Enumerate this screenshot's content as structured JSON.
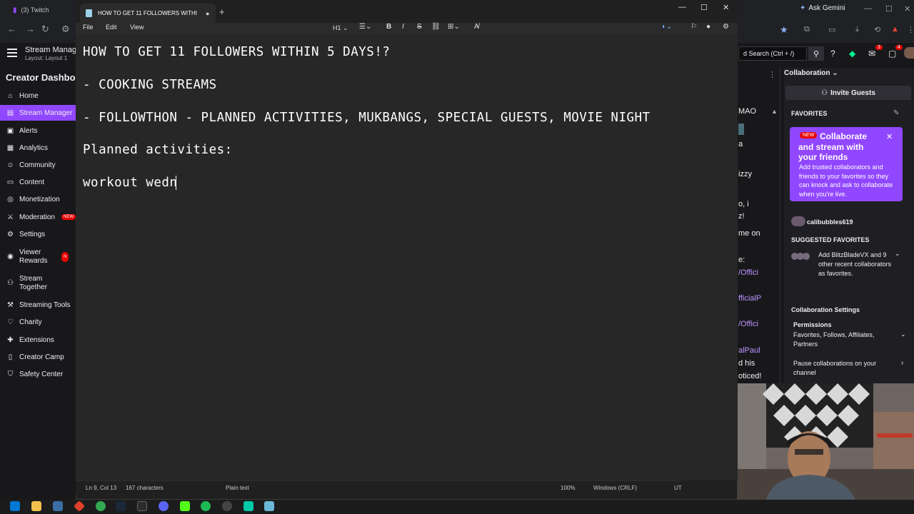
{
  "browser": {
    "tab_title": "(3) Twitch",
    "gemini_label": "Ask Gemini"
  },
  "twitch": {
    "stream_manager_title": "Stream Manage",
    "layout_label": "Layout: Layout 1",
    "creator_dashboard": "Creator Dashboa",
    "nav": [
      {
        "label": "Home",
        "icon": "home-icon"
      },
      {
        "label": "Stream Manager",
        "icon": "stream-manager-icon"
      },
      {
        "label": "Alerts",
        "icon": "alerts-icon"
      },
      {
        "label": "Analytics",
        "icon": "analytics-icon"
      },
      {
        "label": "Community",
        "icon": "community-icon"
      },
      {
        "label": "Content",
        "icon": "content-icon"
      },
      {
        "label": "Monetization",
        "icon": "monetization-icon"
      },
      {
        "label": "Moderation",
        "icon": "moderation-icon"
      },
      {
        "label": "Settings",
        "icon": "settings-icon"
      },
      {
        "label": "Viewer Rewards",
        "icon": "viewer-rewards-icon"
      },
      {
        "label": "Stream Together",
        "icon": "stream-together-icon"
      },
      {
        "label": "Streaming Tools",
        "icon": "streaming-tools-icon"
      },
      {
        "label": "Charity",
        "icon": "charity-icon"
      },
      {
        "label": "Extensions",
        "icon": "extensions-icon"
      },
      {
        "label": "Creator Camp",
        "icon": "creator-camp-icon"
      },
      {
        "label": "Safety Center",
        "icon": "safety-center-icon"
      }
    ],
    "new_badge": "NEW",
    "search_placeholder": "d Search (Ctrl + /)",
    "notif_count_1": "3",
    "notif_count_2": "4",
    "chat_fragments": [
      "MAO",
      "a",
      "izzy",
      "o, i",
      "z!",
      "me on",
      "e:",
      "/Offici",
      "fficialP",
      "/Offici",
      "alPaul",
      "d his",
      "oticed!"
    ],
    "collab": {
      "title": "Collaboration",
      "invite": "Invite Guests",
      "favorites_head": "FAVORITES",
      "new_label": "NEW",
      "card_title": "Collaborate and stream with your friends",
      "card_body": "Add trusted collaborators and friends to your favorites so they can knock and ask to collaborate when you're live.",
      "favorite_user": "calibubbles619",
      "suggested_head": "SUGGESTED FAVORITES",
      "suggested_text": "Add BlitzBladeVX and 9 other recent collaborators as favorites.",
      "settings_head": "Collaboration Settings",
      "permissions_head": "Permissions",
      "permissions_text": "Favorites, Follows, Affiliates, Partners",
      "pause_text": "Pause collaborations on your channel"
    }
  },
  "notepad": {
    "tab_title": "HOW TO GET 11 FOLLOWERS WITHI",
    "menu": [
      "File",
      "Edit",
      "View"
    ],
    "heading_tool": "H1",
    "lines": [
      "HOW TO GET 11 FOLLOWERS WITHIN 5 DAYS!?",
      "- COOKING STREAMS",
      "- FOLLOWTHON - PLANNED ACTIVITIES, MUKBANGS, SPECIAL GUESTS, MOVIE NIGHT",
      "Planned activities:",
      "workout wedn"
    ],
    "status": {
      "position": "Ln 9, Col 13",
      "chars": "167 characters",
      "format": "Plain text",
      "zoom": "100%",
      "line_ending": "Windows (CRLF)",
      "encoding": "UT"
    }
  }
}
